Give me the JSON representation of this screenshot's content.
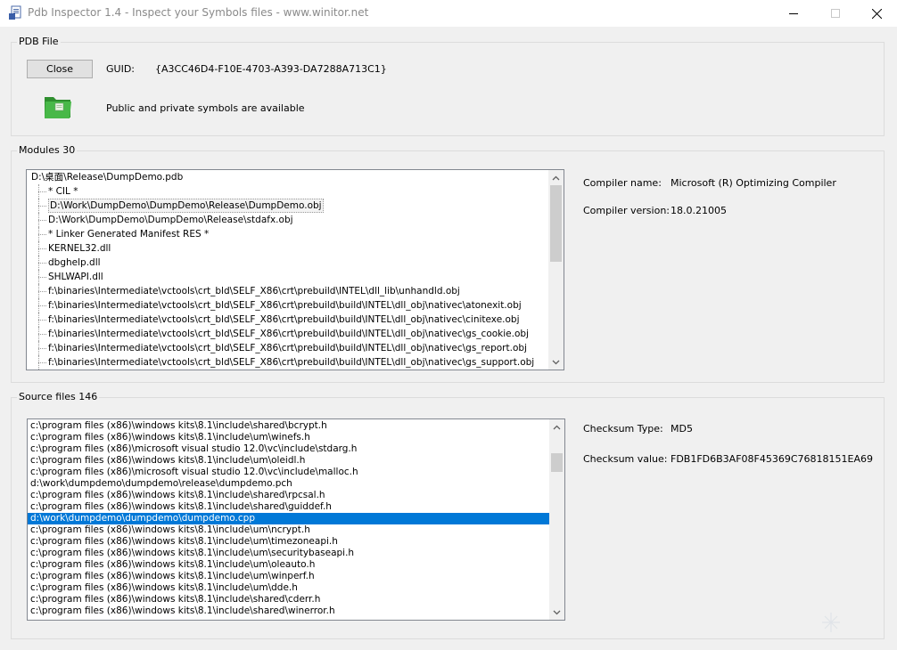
{
  "window": {
    "title": "Pdb Inspector 1.4 - Inspect your Symbols files -  www.winitor.net"
  },
  "pdb_file": {
    "group_label": "PDB File",
    "close_button": "Close",
    "guid_label": "GUID:",
    "guid_value": "{A3CC46D4-F10E-4703-A393-DA7288A713C1}",
    "symbols_status": "Public and private symbols are available"
  },
  "modules": {
    "group_label": "Modules 30",
    "root": "D:\\桌面\\Release\\DumpDemo.pdb",
    "items": [
      "* CIL *",
      "D:\\Work\\DumpDemo\\DumpDemo\\Release\\DumpDemo.obj",
      "D:\\Work\\DumpDemo\\DumpDemo\\Release\\stdafx.obj",
      "* Linker Generated Manifest RES *",
      "KERNEL32.dll",
      "dbghelp.dll",
      "SHLWAPI.dll",
      "f:\\binaries\\Intermediate\\vctools\\crt_bld\\SELF_X86\\crt\\prebuild\\INTEL\\dll_lib\\unhandld.obj",
      "f:\\binaries\\Intermediate\\vctools\\crt_bld\\SELF_X86\\crt\\prebuild\\build\\INTEL\\dll_obj\\nativec\\atonexit.obj",
      "f:\\binaries\\Intermediate\\vctools\\crt_bld\\SELF_X86\\crt\\prebuild\\build\\INTEL\\dll_obj\\nativec\\cinitexe.obj",
      "f:\\binaries\\Intermediate\\vctools\\crt_bld\\SELF_X86\\crt\\prebuild\\build\\INTEL\\dll_obj\\nativec\\gs_cookie.obj",
      "f:\\binaries\\Intermediate\\vctools\\crt_bld\\SELF_X86\\crt\\prebuild\\build\\INTEL\\dll_obj\\nativec\\gs_report.obj",
      "f:\\binaries\\Intermediate\\vctools\\crt_bld\\SELF_X86\\crt\\prebuild\\build\\INTEL\\dll_obj\\nativec\\gs_support.obj"
    ],
    "selected_index": 1,
    "compiler_name_label": "Compiler name:",
    "compiler_name_value": "Microsoft (R) Optimizing Compiler",
    "compiler_version_label": "Compiler version:",
    "compiler_version_value": "18.0.21005"
  },
  "source_files": {
    "group_label": "Source files 146",
    "items": [
      "c:\\program files (x86)\\windows kits\\8.1\\include\\shared\\bcrypt.h",
      "c:\\program files (x86)\\windows kits\\8.1\\include\\um\\winefs.h",
      "c:\\program files (x86)\\microsoft visual studio 12.0\\vc\\include\\stdarg.h",
      "c:\\program files (x86)\\windows kits\\8.1\\include\\um\\oleidl.h",
      "c:\\program files (x86)\\microsoft visual studio 12.0\\vc\\include\\malloc.h",
      "d:\\work\\dumpdemo\\dumpdemo\\release\\dumpdemo.pch",
      "c:\\program files (x86)\\windows kits\\8.1\\include\\shared\\rpcsal.h",
      "c:\\program files (x86)\\windows kits\\8.1\\include\\shared\\guiddef.h",
      "d:\\work\\dumpdemo\\dumpdemo\\dumpdemo.cpp",
      "c:\\program files (x86)\\windows kits\\8.1\\include\\um\\ncrypt.h",
      "c:\\program files (x86)\\windows kits\\8.1\\include\\um\\timezoneapi.h",
      "c:\\program files (x86)\\windows kits\\8.1\\include\\um\\securitybaseapi.h",
      "c:\\program files (x86)\\windows kits\\8.1\\include\\um\\oleauto.h",
      "c:\\program files (x86)\\windows kits\\8.1\\include\\um\\winperf.h",
      "c:\\program files (x86)\\windows kits\\8.1\\include\\um\\dde.h",
      "c:\\program files (x86)\\windows kits\\8.1\\include\\shared\\cderr.h",
      "c:\\program files (x86)\\windows kits\\8.1\\include\\shared\\winerror.h"
    ],
    "selected_index": 8,
    "checksum_type_label": "Checksum Type:",
    "checksum_type_value": "MD5",
    "checksum_value_label": "Checksum value:",
    "checksum_value": "FDB1FD6B3AF08F45369C76818151EA69"
  },
  "icons": {
    "app": "pdb-document-icon",
    "folder": "green-folder-icon",
    "minimize": "minimize-icon",
    "maximize": "maximize-icon",
    "close": "close-icon"
  },
  "colors": {
    "selection": "#0078d7",
    "folder_green": "#3aa83a"
  }
}
